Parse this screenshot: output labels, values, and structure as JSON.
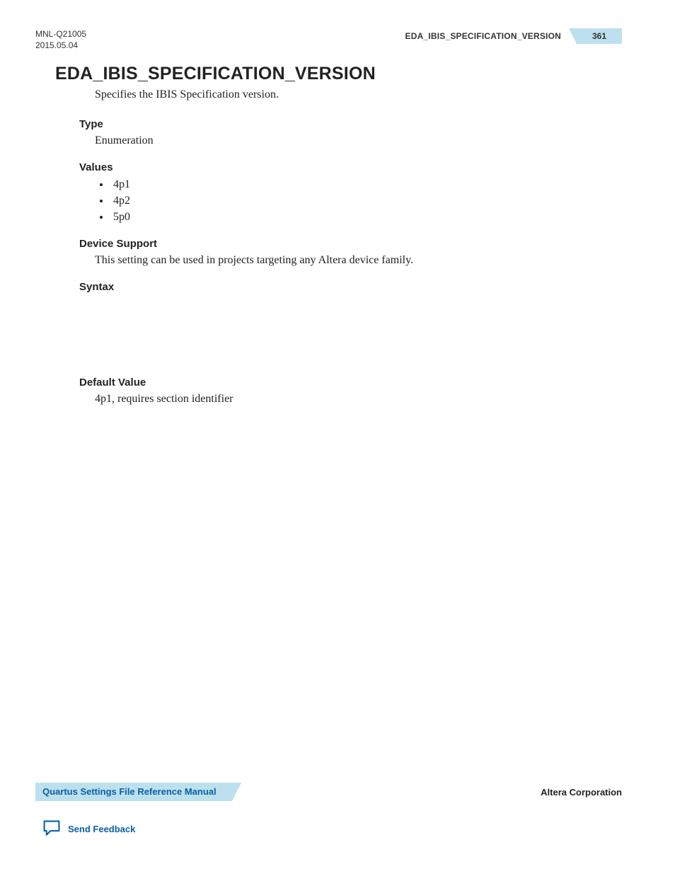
{
  "header": {
    "doc_id": "MNL-Q21005",
    "date": "2015.05.04",
    "section_name": "EDA_IBIS_SPECIFICATION_VERSION",
    "page_number": "361"
  },
  "title": "EDA_IBIS_SPECIFICATION_VERSION",
  "intro": "Specifies the IBIS Specification version.",
  "sections": {
    "type": {
      "head": "Type",
      "body": "Enumeration"
    },
    "values": {
      "head": "Values",
      "items": [
        "4p1",
        "4p2",
        "5p0"
      ]
    },
    "device_support": {
      "head": "Device Support",
      "body": "This setting can be used in projects targeting any Altera device family."
    },
    "syntax": {
      "head": "Syntax"
    },
    "default_value": {
      "head": "Default Value",
      "body": "4p1, requires section identifier"
    }
  },
  "footer": {
    "manual_name": "Quartus Settings File Reference Manual",
    "company": "Altera Corporation",
    "feedback": "Send Feedback"
  }
}
